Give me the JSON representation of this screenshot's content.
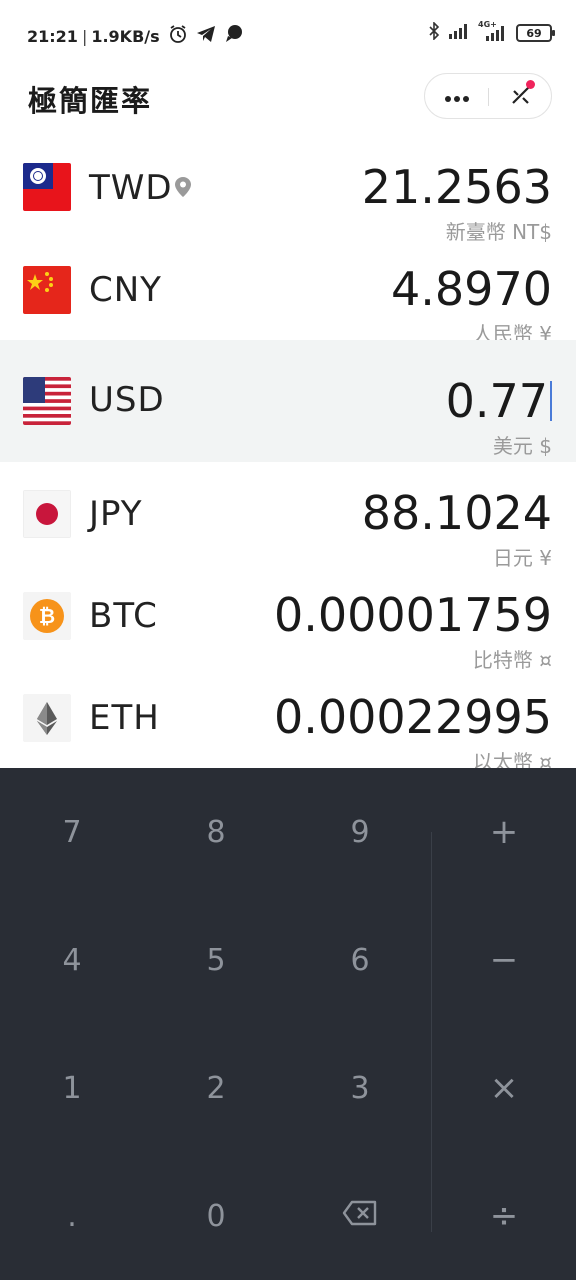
{
  "status_bar": {
    "time": "21:21",
    "speed": "1.9KB/s",
    "network": "4G+",
    "battery": "69",
    "icons": [
      "alarm-icon",
      "telegram-icon",
      "chat-icon",
      "bluetooth-icon",
      "signal-icon",
      "signal-4g-icon",
      "battery-icon"
    ]
  },
  "header": {
    "title": "極簡匯率",
    "menu_icon": "more-dots-icon",
    "close_icon": "close-cross-icon"
  },
  "currencies": [
    {
      "code": "TWD",
      "amount": "21.2563",
      "name": "新臺幣 NT$",
      "flag": "taiwan-flag",
      "located": true
    },
    {
      "code": "CNY",
      "amount": "4.8970",
      "name": "人民幣 ¥",
      "flag": "china-flag"
    },
    {
      "code": "USD",
      "amount": "0.77",
      "name": "美元 $",
      "flag": "usa-flag",
      "active": true
    },
    {
      "code": "JPY",
      "amount": "88.1024",
      "name": "日元 ¥",
      "flag": "japan-flag"
    },
    {
      "code": "BTC",
      "amount": "0.00001759",
      "name": "比特幣 ¤",
      "flag": "bitcoin-logo"
    },
    {
      "code": "ETH",
      "amount": "0.00022995",
      "name": "以太幣 ¤",
      "flag": "ethereum-logo"
    }
  ],
  "keypad": {
    "keys": [
      "7",
      "8",
      "9",
      "+",
      "4",
      "5",
      "6",
      "−",
      "1",
      "2",
      "3",
      "×",
      ".",
      "0",
      "backspace",
      "÷"
    ],
    "backspace_icon": "backspace-icon"
  },
  "colors": {
    "keypad_bg": "#292d35",
    "active_row_bg": "#f2f4f4",
    "badge": "#f0245c",
    "caret": "#4a7bd8"
  }
}
